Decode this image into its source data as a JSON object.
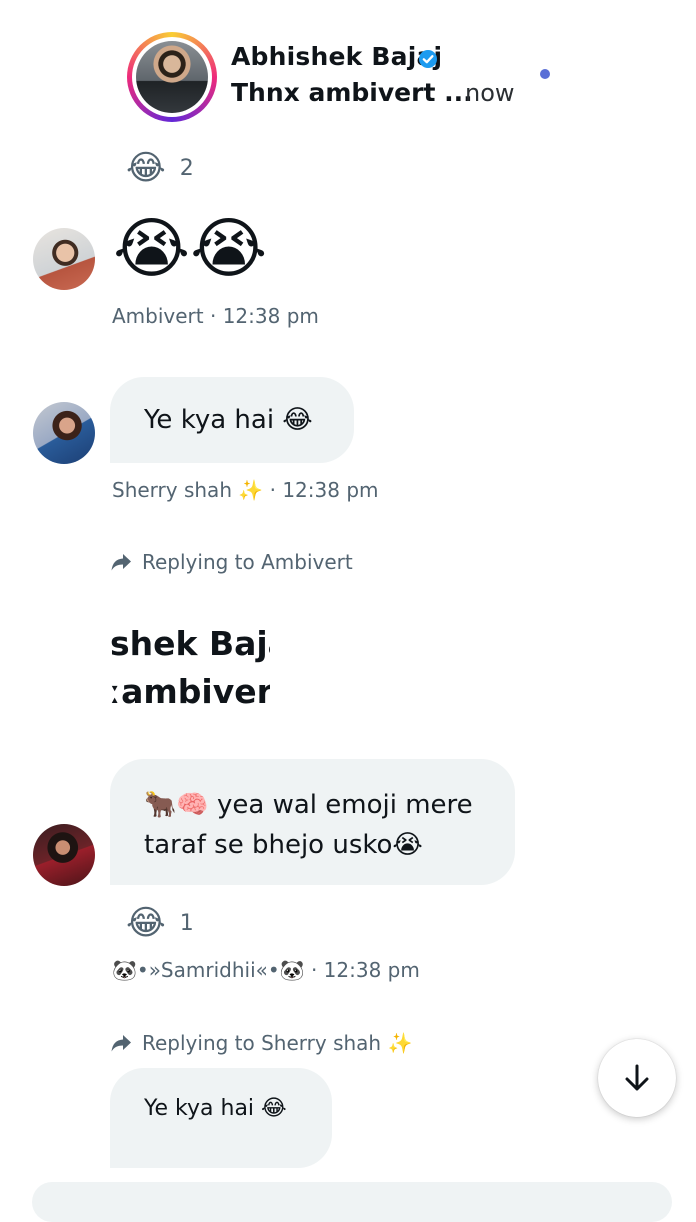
{
  "notification": {
    "name": "Abhishek Bajaj",
    "message": "Thnx ambivert ...",
    "time": "now"
  },
  "reaction_top": {
    "emoji": "😂",
    "count": "2"
  },
  "msg_ambivert": {
    "emojis": "😭😭",
    "sender": "Ambivert",
    "time": "12:38 pm"
  },
  "msg_sherry": {
    "text": "Ye kya hai 😂",
    "sender": "Sherry shah ✨",
    "time": "12:38 pm"
  },
  "reply1": {
    "label": "Replying to Ambivert",
    "quoted_line1": "shek Baja",
    "quoted_line2": "ambiver"
  },
  "msg_samridhi": {
    "line1": "🐂🧠 yea wal emoji mere",
    "line2": "taraf se bhejo usko😭",
    "reaction_emoji": "😂",
    "reaction_count": "1",
    "sender": "🐼•»Samridhii«•🐼",
    "time": "12:38 pm"
  },
  "reply2": {
    "label": "Replying to Sherry shah ✨",
    "quoted_text": "Ye kya hai 😂"
  },
  "separator": "·",
  "colors": {
    "meta": "#536471",
    "bubble": "#eff3f4",
    "verified": "#1d9bf0",
    "unread": "#5a6fd6"
  }
}
